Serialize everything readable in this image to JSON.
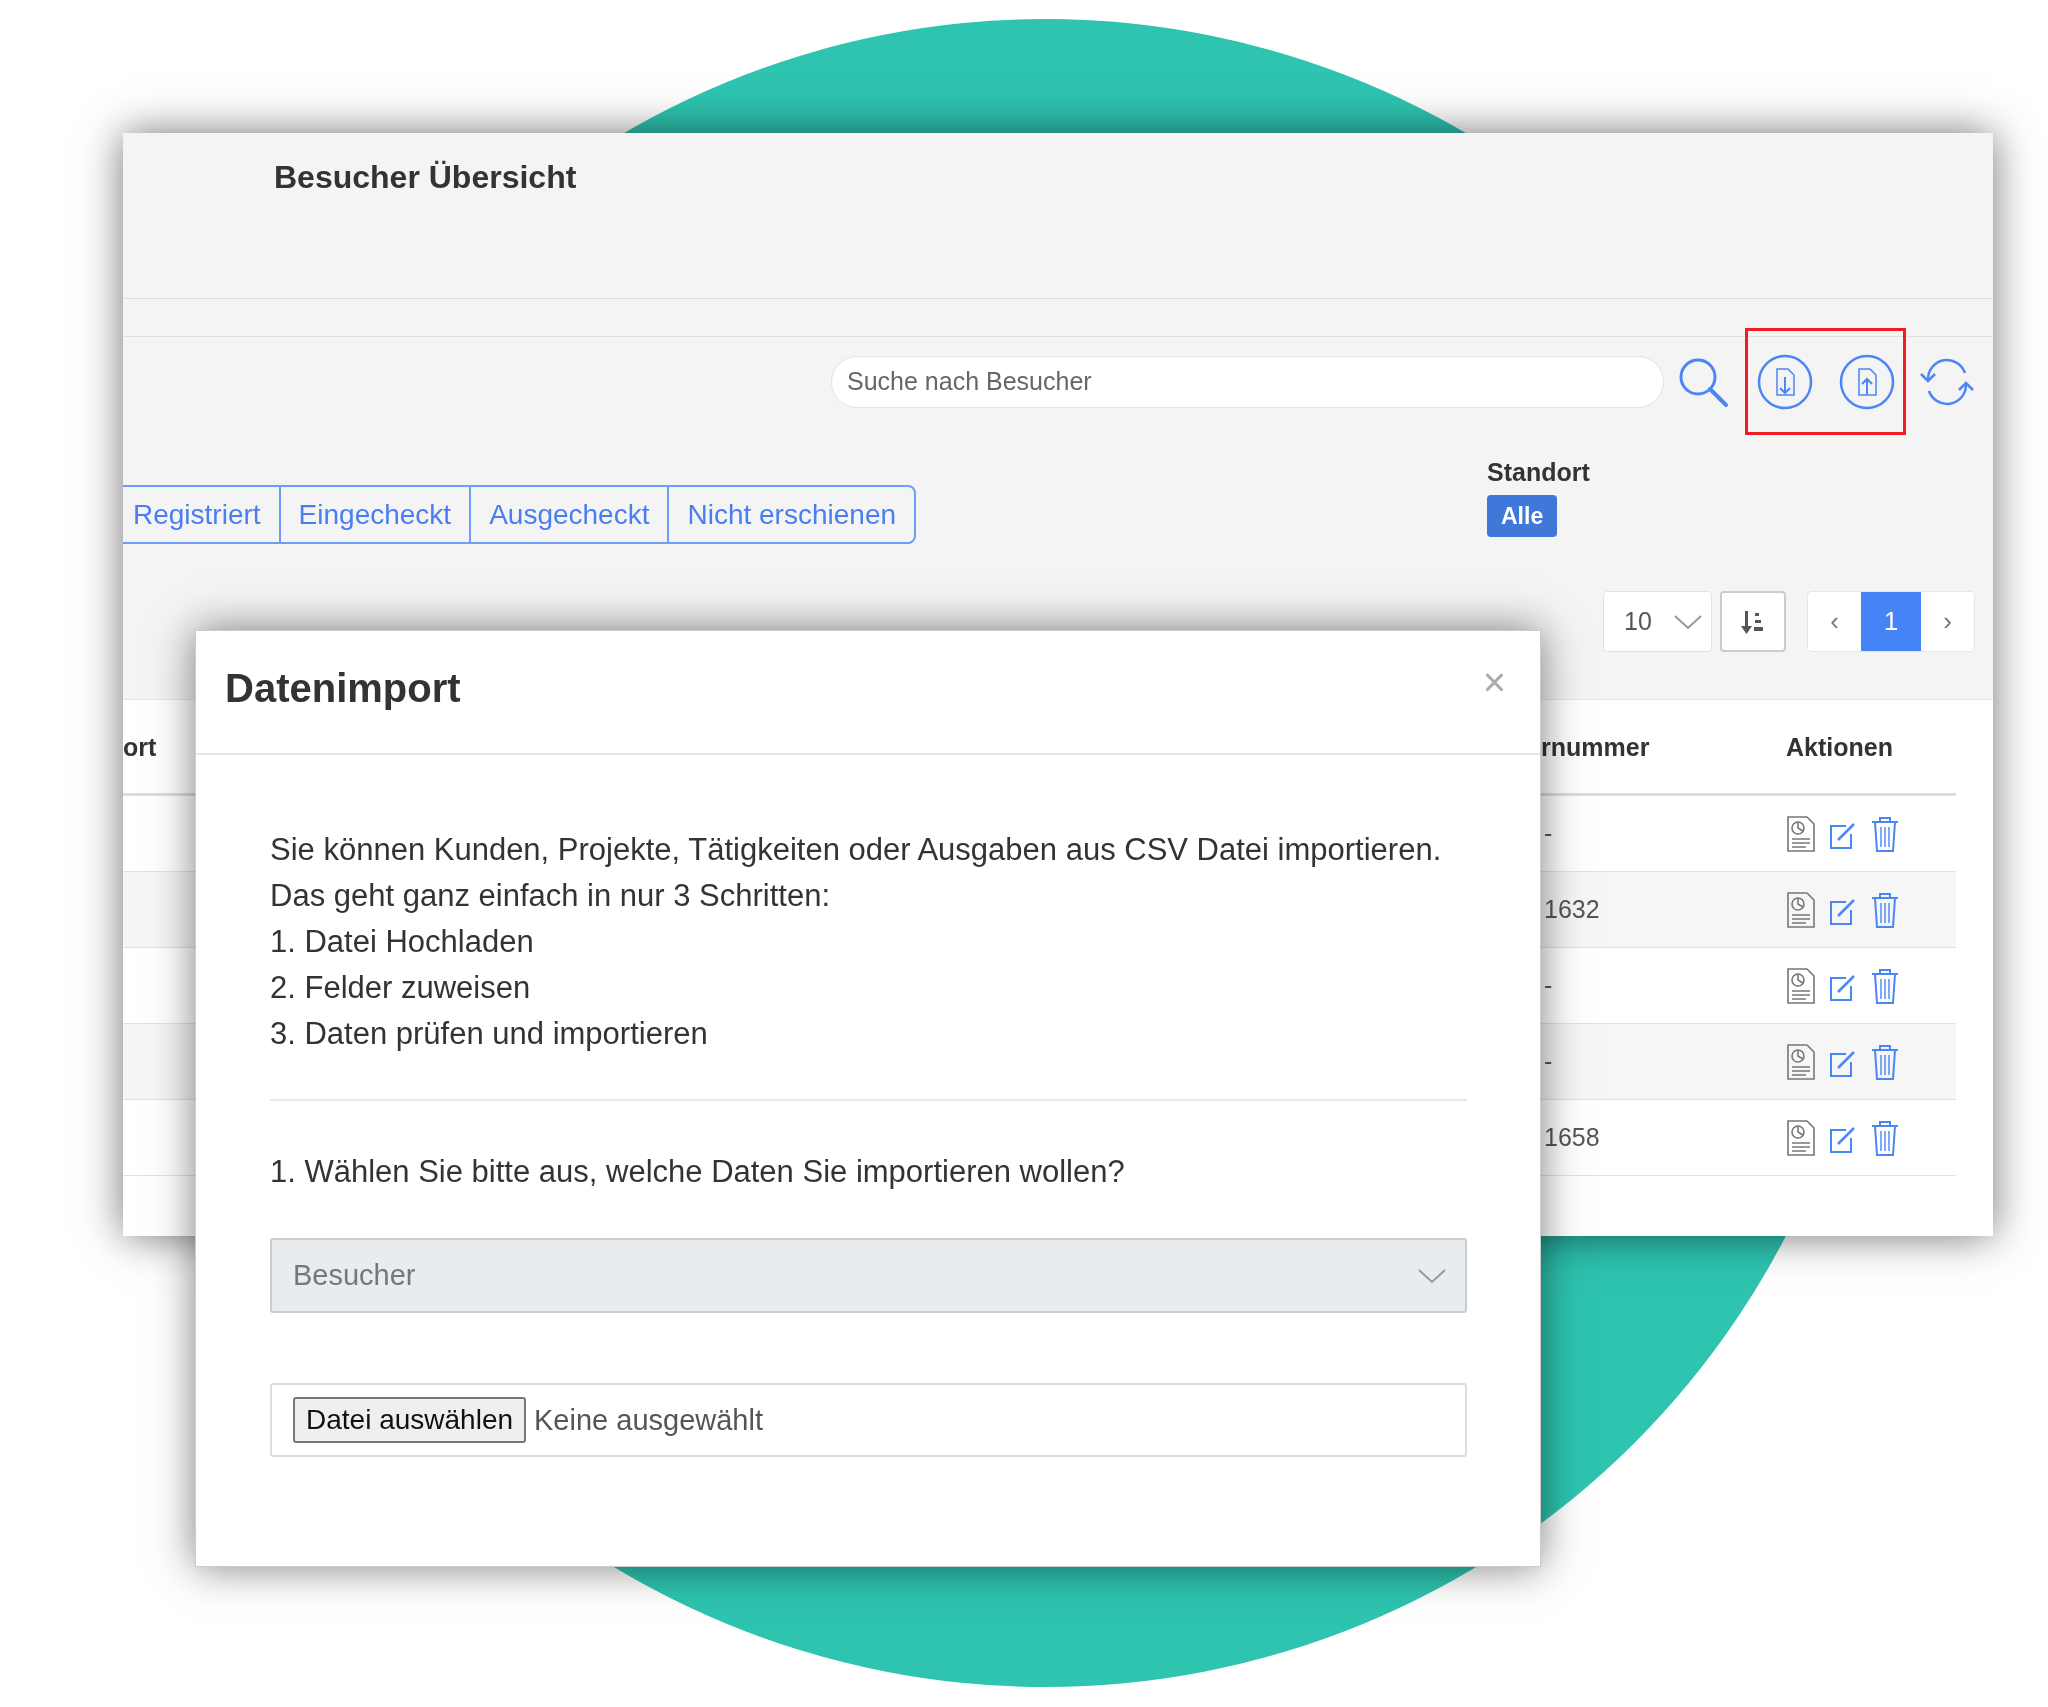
{
  "app": {
    "title": "Besucher Übersicht",
    "search": {
      "placeholder": "Suche nach Besucher"
    },
    "status_tabs": [
      {
        "label": "Registriert",
        "selected": false
      },
      {
        "label": "Eingecheckt",
        "selected": false
      },
      {
        "label": "Ausgecheckt",
        "selected": false
      },
      {
        "label": "Nicht erschienen",
        "selected": false
      }
    ],
    "location_filter": {
      "label": "Standort",
      "value": "Alle"
    },
    "page_size": "10",
    "pagination": {
      "previous": "‹",
      "next": "›",
      "pages": [
        {
          "label": "1",
          "selected": true
        }
      ]
    },
    "table": {
      "columns": [
        "ort",
        "rnummer",
        "Aktionen"
      ],
      "rows": [
        {
          "column_2": "-"
        },
        {
          "column_2": "1632"
        },
        {
          "column_2": "-"
        },
        {
          "column_2": "-"
        },
        {
          "column_2": "1658"
        }
      ]
    }
  },
  "modal": {
    "title": "Datenimport",
    "close": "×",
    "intro": [
      "Sie können Kunden, Projekte, Tätigkeiten oder Ausgaben aus CSV Datei importieren.",
      "Das geht ganz einfach in nur 3 Schritten:"
    ],
    "steps": [
      "1. Datei Hochladen",
      "2. Felder zuweisen",
      "3. Daten prüfen und importieren"
    ],
    "question": "1. Wählen Sie bitte aus, welche Daten Sie importieren wollen?",
    "data_type": {
      "value": "Besucher",
      "disabled": true
    },
    "file": {
      "button": "Datei auswählen",
      "status": "Keine ausgewählt"
    }
  }
}
